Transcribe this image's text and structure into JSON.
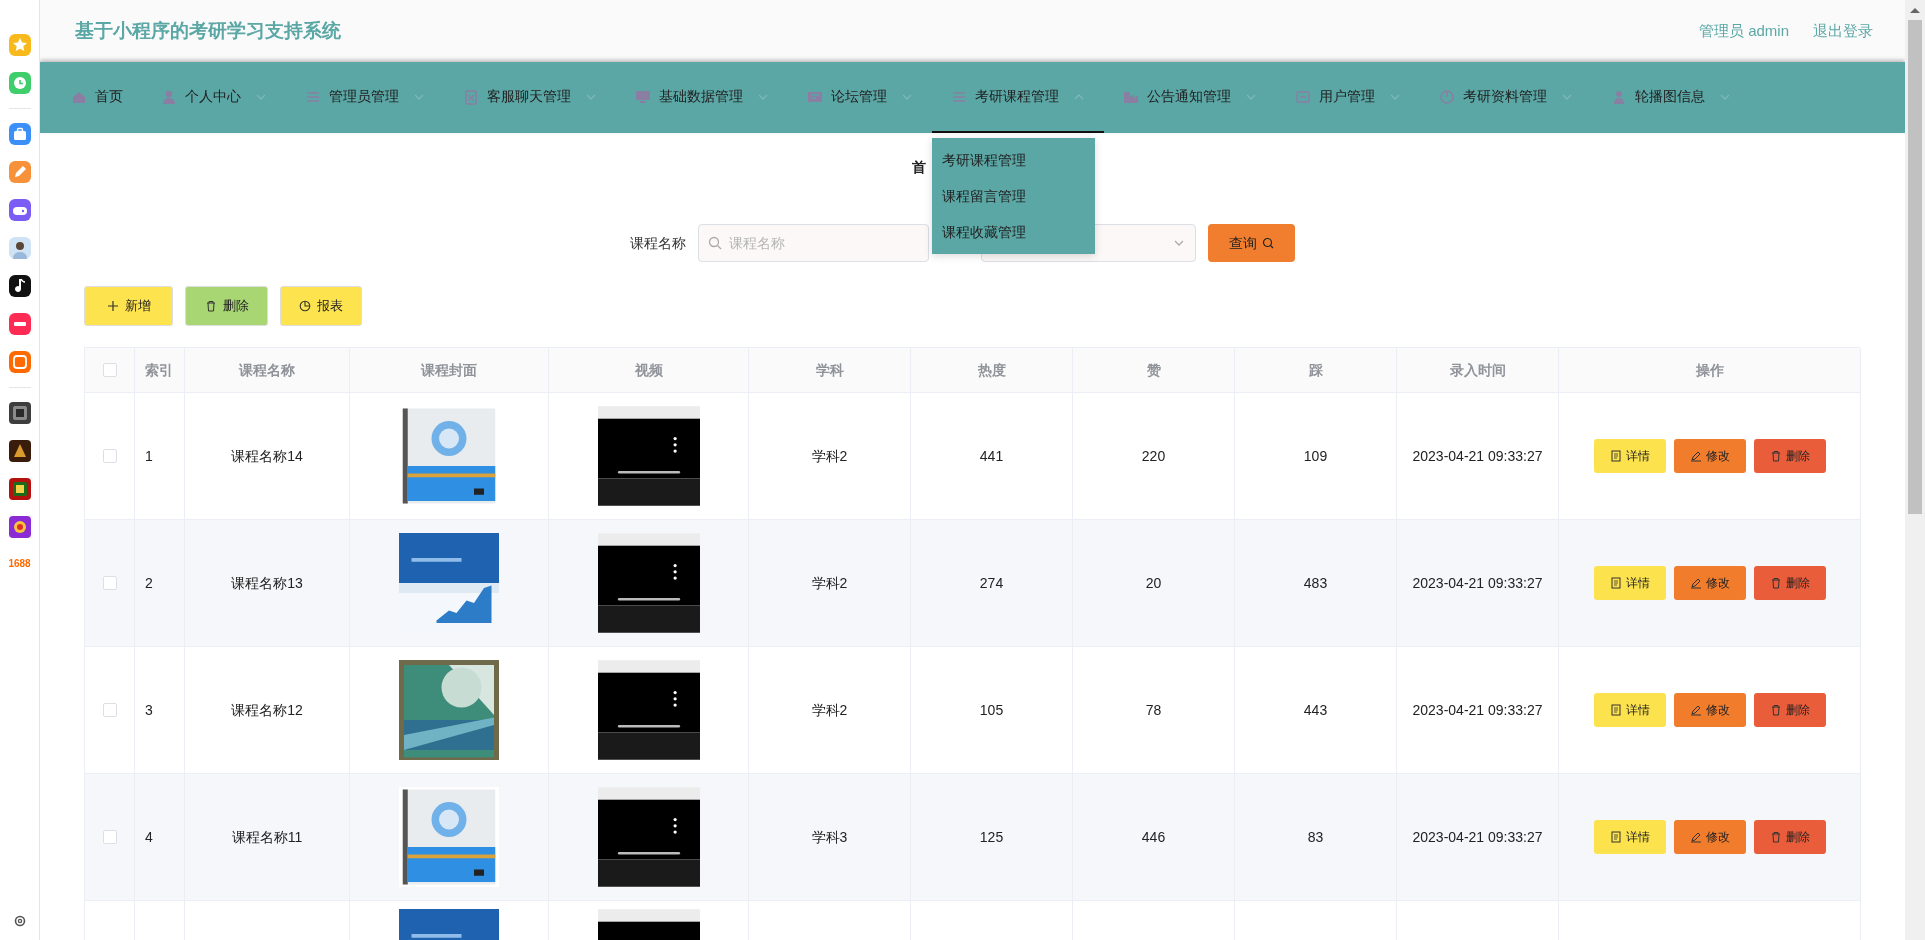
{
  "dock": {
    "label": "1688"
  },
  "header": {
    "title": "基于小程序的考研学习支持系统",
    "user": "管理员 admin",
    "logout": "退出登录"
  },
  "nav": [
    {
      "label": "首页",
      "kind": "link",
      "selected": false
    },
    {
      "label": "个人中心",
      "kind": "menu",
      "selected": false,
      "expanded": false
    },
    {
      "label": "管理员管理",
      "kind": "menu",
      "selected": false,
      "expanded": false
    },
    {
      "label": "客服聊天管理",
      "kind": "menu",
      "selected": false,
      "expanded": false
    },
    {
      "label": "基础数据管理",
      "kind": "menu",
      "selected": false,
      "expanded": false
    },
    {
      "label": "论坛管理",
      "kind": "menu",
      "selected": false,
      "expanded": false
    },
    {
      "label": "考研课程管理",
      "kind": "menu",
      "selected": true,
      "expanded": true,
      "children": [
        {
          "label": "考研课程管理"
        },
        {
          "label": "课程留言管理"
        },
        {
          "label": "课程收藏管理"
        }
      ]
    },
    {
      "label": "公告通知管理",
      "kind": "menu",
      "selected": false,
      "expanded": false
    },
    {
      "label": "用户管理",
      "kind": "menu",
      "selected": false,
      "expanded": false
    },
    {
      "label": "考研资料管理",
      "kind": "menu",
      "selected": false,
      "expanded": false
    },
    {
      "label": "轮播图信息",
      "kind": "menu",
      "selected": false,
      "expanded": false
    }
  ],
  "breadcrumb": "首",
  "search": {
    "label": "课程名称",
    "placeholder": "课程名称",
    "button": "查询"
  },
  "actions": [
    {
      "label": "新增",
      "kind": "add"
    },
    {
      "label": "删除",
      "kind": "delete"
    },
    {
      "label": "报表",
      "kind": "report"
    }
  ],
  "table": {
    "all_checked": false,
    "columns": [
      "索引",
      "课程名称",
      "课程封面",
      "视频",
      "学科",
      "热度",
      "赞",
      "踩",
      "录入时间",
      "操作"
    ],
    "rows": [
      {
        "kind": "full",
        "checked": false,
        "index": "1",
        "name": "课程名称14",
        "subject": "学科2",
        "heat": "441",
        "likes": "220",
        "dislikes": "109",
        "time": "2023-04-21 09:33:27",
        "actions": [
          "详情",
          "修改",
          "删除"
        ]
      },
      {
        "kind": "full",
        "checked": false,
        "index": "2",
        "name": "课程名称13",
        "subject": "学科2",
        "heat": "274",
        "likes": "20",
        "dislikes": "483",
        "time": "2023-04-21 09:33:27",
        "actions": [
          "详情",
          "修改",
          "删除"
        ]
      },
      {
        "kind": "full",
        "checked": false,
        "index": "3",
        "name": "课程名称12",
        "subject": "学科2",
        "heat": "105",
        "likes": "78",
        "dislikes": "443",
        "time": "2023-04-21 09:33:27",
        "actions": [
          "详情",
          "修改",
          "删除"
        ]
      },
      {
        "kind": "full",
        "checked": false,
        "index": "4",
        "name": "课程名称11",
        "subject": "学科3",
        "heat": "125",
        "likes": "446",
        "dislikes": "83",
        "time": "2023-04-21 09:33:27",
        "actions": [
          "详情",
          "修改",
          "删除"
        ]
      },
      {
        "kind": "partial"
      }
    ]
  }
}
